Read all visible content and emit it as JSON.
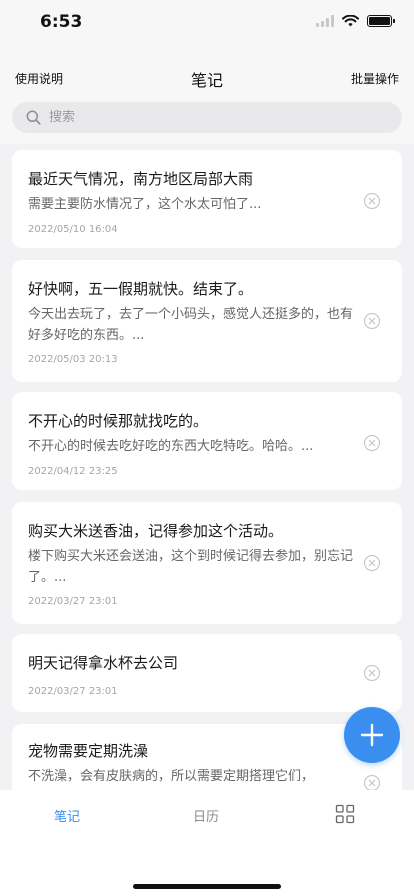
{
  "status_bar": {
    "time": "6:53"
  },
  "header": {
    "left_label": "使用说明",
    "title": "笔记",
    "right_label": "批量操作"
  },
  "search": {
    "placeholder": "搜索",
    "value": ""
  },
  "notes": [
    {
      "title": "最近天气情况，南方地区局部大雨",
      "preview": "需要主要防水情况了，这个水太可怕了...",
      "date": "2022/05/10 16:04"
    },
    {
      "title": "好快啊，五一假期就快。结束了。",
      "preview": "今天出去玩了，去了一个小码头，感觉人还挺多的，也有好多好吃的东西。...",
      "date": "2022/05/03 20:13"
    },
    {
      "title": "不开心的时候那就找吃的。",
      "preview": "不开心的时候去吃好吃的东西大吃特吃。哈哈。...",
      "date": "2022/04/12 23:25"
    },
    {
      "title": "购买大米送香油，记得参加这个活动。",
      "preview": "楼下购买大米还会送油，这个到时候记得去参加，别忘记了。...",
      "date": "2022/03/27 23:01"
    },
    {
      "title": "明天记得拿水杯去公司",
      "preview": "",
      "date": "2022/03/27 23:01"
    },
    {
      "title": "宠物需要定期洗澡",
      "preview": "不洗澡，会有皮肤病的，所以需要定期搭理它们，",
      "date": ""
    }
  ],
  "tab_bar": {
    "notes_label": "笔记",
    "calendar_label": "日历"
  },
  "colors": {
    "accent": "#3a8ef0",
    "background": "#f2f2f4",
    "card": "#ffffff"
  },
  "icons": {
    "search": "search-icon",
    "delete": "close-circle-icon",
    "add": "plus-icon",
    "more": "grid-icon"
  }
}
